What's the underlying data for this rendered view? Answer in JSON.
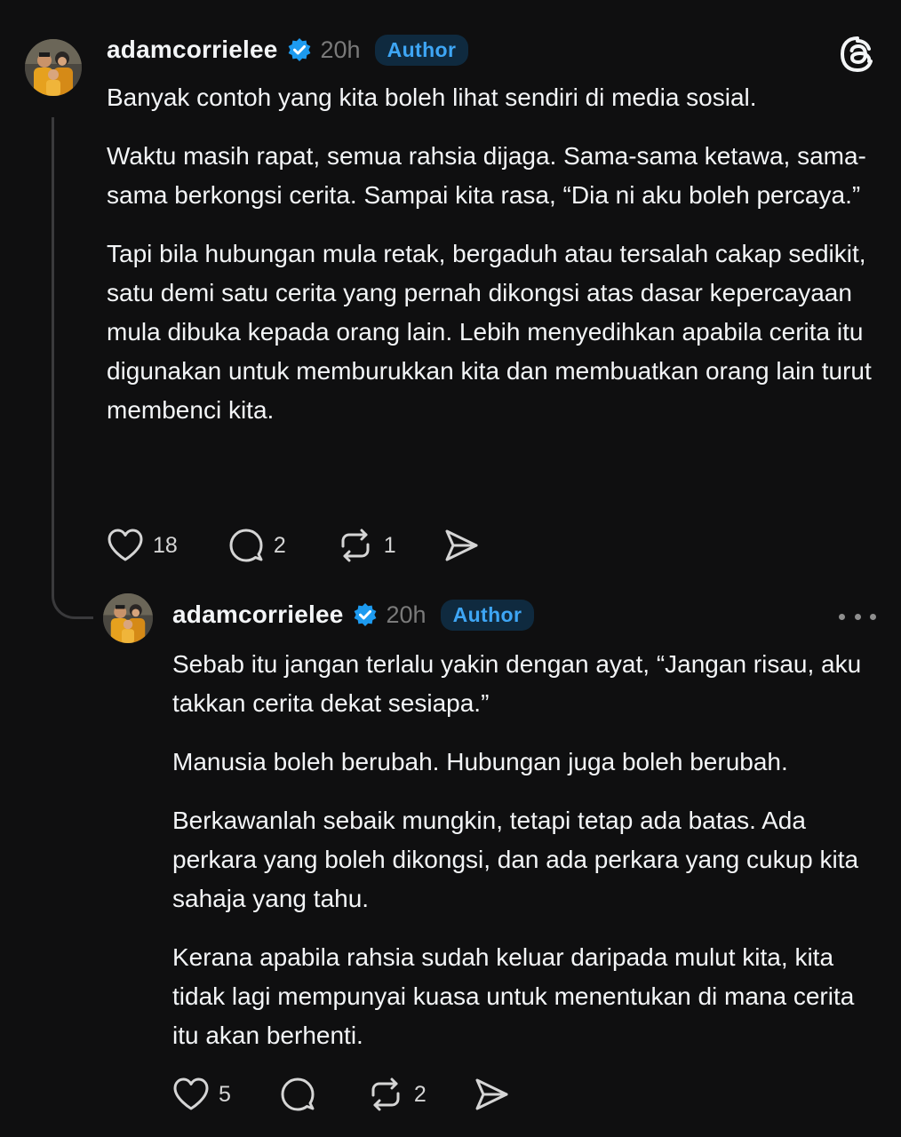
{
  "colors": {
    "background": "#0f0f10",
    "text": "#f3f5f7",
    "muted": "#7a7a7a",
    "verified": "#1d9bf0",
    "author_badge_text": "#3ea6f5",
    "author_badge_bg": "#0f2a3f"
  },
  "app": {
    "logo_icon": "threads-logo-icon",
    "more_icon": "more-horizontal-icon"
  },
  "posts": [
    {
      "username": "adamcorrielee",
      "time": "20h",
      "badge": "Author",
      "paragraphs": [
        "Banyak contoh yang kita boleh lihat sendiri di media sosial.",
        "Waktu masih rapat, semua rahsia dijaga. Sama-sama ketawa, sama-sama berkongsi cerita. Sampai kita rasa, “Dia ni aku boleh percaya.”",
        "Tapi bila hubungan mula retak, bergaduh atau tersalah cakap sedikit, satu demi satu cerita yang pernah dikongsi atas dasar kepercayaan mula dibuka kepada orang lain. Lebih menyedihkan apabila cerita itu digunakan untuk memburukkan kita dan membuatkan orang lain turut membenci kita."
      ],
      "likes": "18",
      "comments": "2",
      "reposts": "1"
    },
    {
      "username": "adamcorrielee",
      "time": "20h",
      "badge": "Author",
      "paragraphs": [
        "Sebab itu jangan terlalu yakin dengan ayat, “Jangan risau, aku takkan cerita dekat sesiapa.”",
        "Manusia boleh berubah. Hubungan juga boleh berubah.",
        "Berkawanlah sebaik mungkin, tetapi tetap ada batas. Ada perkara yang boleh dikongsi, dan ada perkara yang cukup kita sahaja yang tahu.",
        "Kerana apabila rahsia sudah keluar daripada mulut kita, kita tidak lagi mempunyai kuasa untuk menentukan di mana cerita itu akan berhenti."
      ],
      "likes": "5",
      "reposts": "2"
    }
  ]
}
